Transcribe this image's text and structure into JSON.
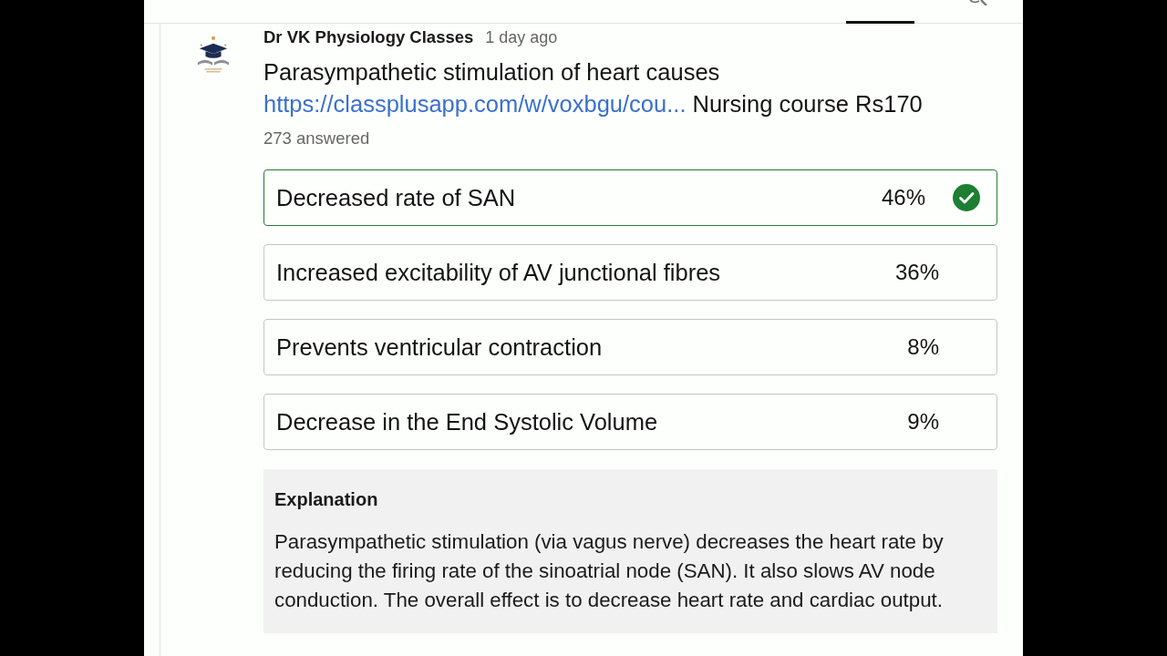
{
  "post": {
    "channel": "Dr VK Physiology Classes",
    "time": "1 day ago",
    "question": "Parasympathetic stimulation of heart causes",
    "link": "https://classplusapp.com/w/voxbgu/cou...",
    "note": "Nursing course Rs170",
    "answered": "273 answered"
  },
  "options": [
    {
      "text": "Decreased rate of SAN",
      "percent": "46%",
      "correct": true
    },
    {
      "text": "Increased excitability of AV junctional fibres",
      "percent": "36%",
      "correct": false
    },
    {
      "text": "Prevents ventricular contraction",
      "percent": "8%",
      "correct": false
    },
    {
      "text": "Decrease in the End Systolic Volume",
      "percent": "9%",
      "correct": false
    }
  ],
  "explanation": {
    "title": "Explanation",
    "text": "Parasympathetic stimulation (via vagus nerve) decreases the heart rate by reducing the firing rate of the sinoatrial node (SAN). It also slows AV node conduction. The overall effect is to decrease heart rate and cardiac output."
  }
}
